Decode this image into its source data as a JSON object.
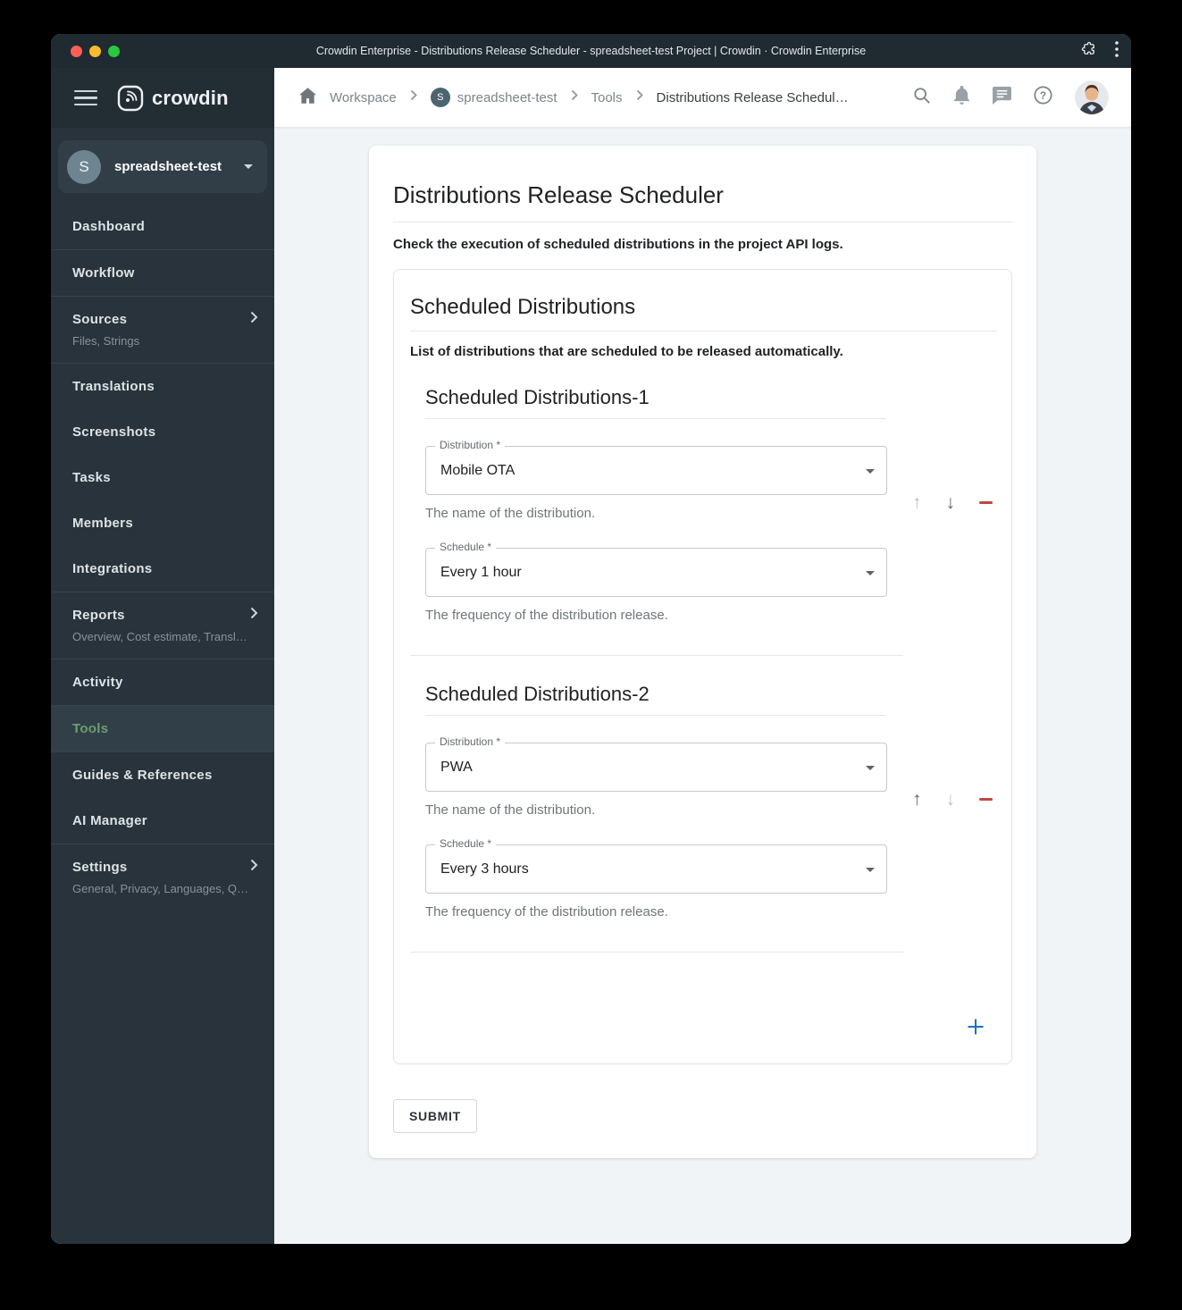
{
  "titlebar": {
    "title": "Crowdin Enterprise - Distributions Release Scheduler - spreadsheet-test Project | Crowdin · Crowdin Enterprise"
  },
  "breadcrumb": {
    "workspace": "Workspace",
    "project_initial": "S",
    "project": "spreadsheet-test",
    "tools": "Tools",
    "current": "Distributions Release Schedul…"
  },
  "sidebar": {
    "logo_text": "crowdin",
    "project_initial": "S",
    "project_name": "spreadsheet-test",
    "items": [
      {
        "label": "Dashboard"
      },
      {
        "label": "Workflow"
      },
      {
        "label": "Sources",
        "subtitle": "Files, Strings"
      },
      {
        "label": "Translations"
      },
      {
        "label": "Screenshots"
      },
      {
        "label": "Tasks"
      },
      {
        "label": "Members"
      },
      {
        "label": "Integrations"
      },
      {
        "label": "Reports",
        "subtitle": "Overview, Cost estimate, Transl…"
      },
      {
        "label": "Activity"
      },
      {
        "label": "Tools"
      },
      {
        "label": "Guides & References"
      },
      {
        "label": "AI Manager"
      },
      {
        "label": "Settings",
        "subtitle": "General, Privacy, Languages, Q…"
      }
    ]
  },
  "main": {
    "page_title": "Distributions Release Scheduler",
    "page_subtitle": "Check the execution of scheduled distributions in the project API logs.",
    "card_title": "Scheduled Distributions",
    "card_subtitle": "List of distributions that are scheduled to be released automatically.",
    "sections": [
      {
        "title": "Scheduled Distributions-1",
        "distribution_label": "Distribution *",
        "distribution_value": "Mobile OTA",
        "distribution_help": "The name of the distribution.",
        "schedule_label": "Schedule *",
        "schedule_value": "Every 1 hour",
        "schedule_help": "The frequency of the distribution release."
      },
      {
        "title": "Scheduled Distributions-2",
        "distribution_label": "Distribution *",
        "distribution_value": "PWA",
        "distribution_help": "The name of the distribution.",
        "schedule_label": "Schedule *",
        "schedule_value": "Every 3 hours",
        "schedule_help": "The frequency of the distribution release."
      }
    ],
    "submit_label": "SUBMIT"
  },
  "colors": {
    "titlebar_bg": "#1f2a31",
    "sidebar_bg": "#28333b",
    "active_item_green": "#6d9e70",
    "add_button_blue": "#1a6fc4",
    "remove_button_red": "#c0483f",
    "content_bg": "#f1f4f7",
    "traffic_red": "#ff5f57",
    "traffic_yellow": "#febc2e",
    "traffic_green": "#28c840"
  }
}
